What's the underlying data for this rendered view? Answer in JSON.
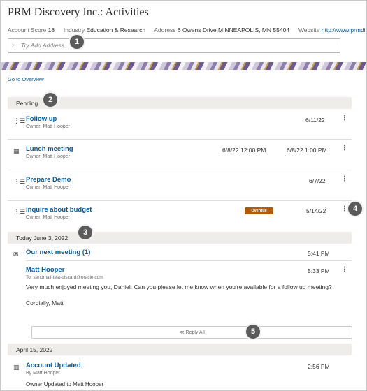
{
  "header": {
    "title": "PRM Discovery Inc.: Activities",
    "account_score_label": "Account Score",
    "account_score": "18",
    "industry_label": "Industry",
    "industry": "Education & Research",
    "address_label": "Address",
    "address": "6 Owens Drive,MINNEAPOLIS, MN 55404",
    "website_label": "Website",
    "website": "http://www.prmdi"
  },
  "address_input": {
    "placeholder": "Try Add Address"
  },
  "overview_link": "Go to Overview",
  "sections": {
    "pending": "Pending",
    "today": "Today June 3, 2022",
    "april": "April 15, 2022"
  },
  "pending_items": [
    {
      "name": "Follow up",
      "owner": "Owner: Matt Hooper",
      "date": "6/11/22",
      "icon": "task-list-icon"
    },
    {
      "name": "Lunch meeting",
      "owner": "Owner: Matt Hooper",
      "start": "6/8/22 12:00 PM",
      "end": "6/8/22 1:00 PM",
      "icon": "calendar-icon"
    },
    {
      "name": "Prepare Demo",
      "owner": "Owner: Matt Hooper",
      "date": "6/7/22",
      "icon": "task-list-icon"
    },
    {
      "name": "inquire about budget",
      "owner": "Owner: Matt Hooper",
      "badge": "Overdue",
      "date": "5/14/22",
      "icon": "task-list-icon"
    }
  ],
  "email_thread": {
    "subject": "Our next meeting (1)",
    "time": "5:41 PM",
    "message": {
      "from": "Matt Hooper",
      "to": "To: sendmail-test-discard@oracle.com",
      "time": "5:33 PM",
      "body": "Very much enjoyed meeting you, Daniel. Can you please let me know when you're available for a follow up meeting?",
      "signoff": "Cordially, Matt"
    },
    "reply_all": "Reply All"
  },
  "april_items": [
    {
      "name": "Account Updated",
      "owner": "By Matt Hooper",
      "time": "2:56 PM",
      "detail": "Owner Updated to Matt Hooper"
    }
  ],
  "callouts": [
    "1",
    "2",
    "3",
    "4",
    "5"
  ],
  "colors": {
    "link": "#0d5a93",
    "overdue_badge": "#b05a0c",
    "section_bg": "#efedea",
    "callout": "#5b5b5b"
  }
}
